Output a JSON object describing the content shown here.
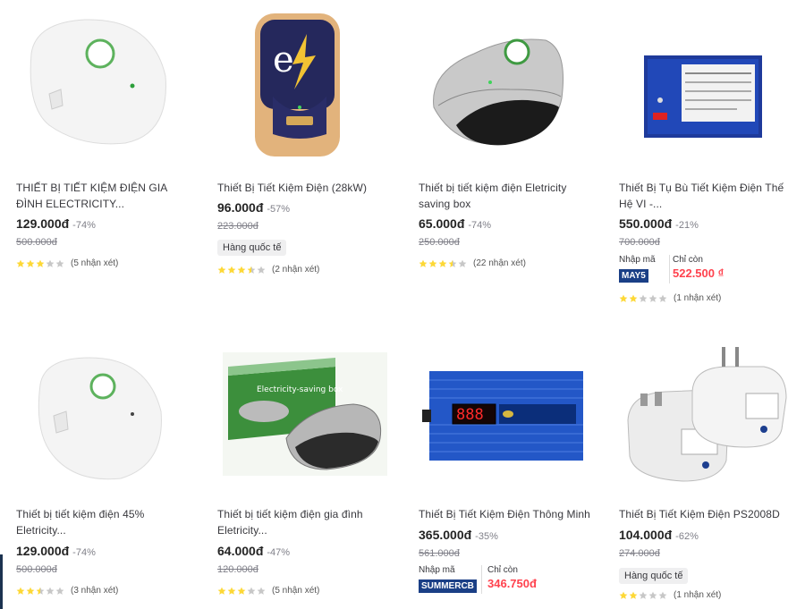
{
  "products": [
    {
      "title": "THIẾT BỊ TIẾT KIỆM ĐIỆN GIA ĐÌNH ELECTRICITY...",
      "price": "129.000đ",
      "discount": "-74%",
      "old_price": "500.000đ",
      "rating": 3,
      "reviews": "(5 nhận xét)",
      "icon": "white-saver-product-image"
    },
    {
      "title": "Thiết Bị Tiết Kiệm Điện (28kW)",
      "price": "96.000đ",
      "discount": "-57%",
      "old_price": "223.000đ",
      "badge": "Hàng quốc tế",
      "rating": 3.5,
      "reviews": "(2 nhận xét)",
      "icon": "gold-power-saver-product-image"
    },
    {
      "title": "Thiết bị tiết kiệm điện Eletricity saving box",
      "price": "65.000đ",
      "discount": "-74%",
      "old_price": "250.000đ",
      "rating": 3.5,
      "reviews": "(22 nhận xét)",
      "icon": "silver-black-saver-product-image"
    },
    {
      "title": "Thiết Bị Tụ Bù Tiết Kiệm Điện Thế Hệ VI -...",
      "price": "550.000đ",
      "discount": "-21%",
      "old_price": "700.000đ",
      "coupon": {
        "label": "Nhập mã",
        "code": "MAY5",
        "remain_label": "Chỉ còn",
        "final_price": "522.500 ₫"
      },
      "rating": 2,
      "reviews": "(1 nhận xét)",
      "icon": "blue-box-capacitor-product-image"
    },
    {
      "title": "Thiết bị tiết kiệm điện 45% Eletricity...",
      "price": "129.000đ",
      "discount": "-74%",
      "old_price": "500.000đ",
      "rating": 2.5,
      "reviews": "(3 nhận xét)",
      "icon": "white-saver-product-image"
    },
    {
      "title": "Thiết bị tiết kiệm điện gia đình Eletricity...",
      "price": "64.000đ",
      "discount": "-47%",
      "old_price": "120.000đ",
      "rating": 3,
      "reviews": "(5 nhận xét)",
      "icon": "electricity-saving-box-product-image"
    },
    {
      "title": "Thiết Bị Tiết Kiệm Điện Thông Minh",
      "price": "365.000đ",
      "discount": "-35%",
      "old_price": "561.000đ",
      "coupon": {
        "label": "Nhập mã",
        "code": "SUMMERCB",
        "remain_label": "Chỉ còn",
        "final_price": "346.750đ"
      },
      "icon": "blue-smart-energy-saver-product-image"
    },
    {
      "title": "Thiết Bị Tiết Kiệm Điện PS2008D",
      "price": "104.000đ",
      "discount": "-62%",
      "old_price": "274.000đ",
      "badge": "Hàng quốc tế",
      "rating": 2,
      "reviews": "(1 nhận xét)",
      "icon": "ps2008d-saver-product-image"
    }
  ],
  "colors": {
    "star_filled": "#fdd836",
    "star_empty": "#c7c7c7",
    "coupon_bg": "#1a3f86",
    "final_price": "#ff424e"
  }
}
